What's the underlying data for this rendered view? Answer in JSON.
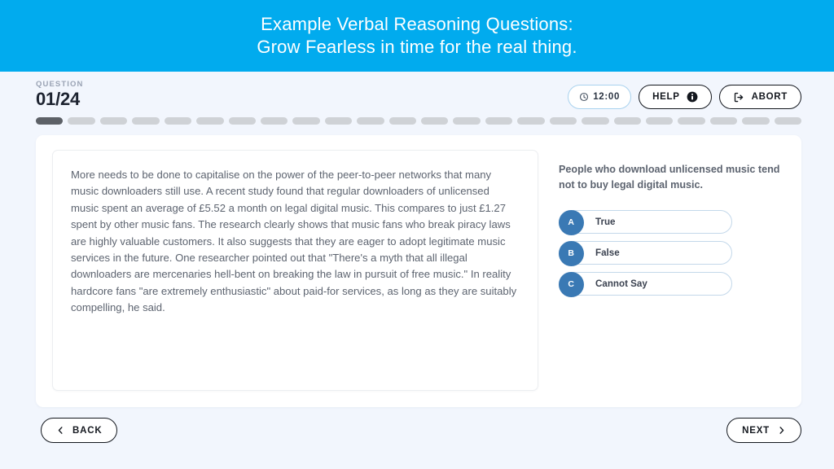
{
  "banner": {
    "line1": "Example Verbal Reasoning Questions:",
    "line2": "Grow Fearless in time for the real thing.",
    "background_color": "#01ABEE"
  },
  "header": {
    "question_label": "QUESTION",
    "question_counter": "01/24",
    "timer": {
      "value": "12:00",
      "icon": "clock-icon",
      "border_color": "#a9d2ee"
    },
    "help_button": {
      "label": "HELP",
      "icon": "info-icon"
    },
    "abort_button": {
      "label": "ABORT",
      "icon": "exit-icon"
    }
  },
  "progress": {
    "total": 24,
    "current": 1,
    "active_color": "#5d6167",
    "inactive_color": "#cfd2d6"
  },
  "passage": {
    "text": "More needs to be done to capitalise on the power of the peer-to-peer networks that many music downloaders still use. A recent study found that regular downloaders of unlicensed music spent an average of £5.52 a month on legal digital music. This compares to just £1.27 spent by other music fans. The research clearly shows that music fans who break piracy laws are highly valuable customers. It also suggests that they are eager to adopt legitimate music services in the future. One researcher pointed out that \"There's a myth that all illegal downloaders are mercenaries hell-bent on breaking the law in pursuit of free music.\" In reality hardcore fans \"are extremely enthusiastic\" about paid-for services, as long as they are suitably compelling, he said."
  },
  "question": {
    "statement": "People who download unlicensed music tend not to buy legal digital music.",
    "options": [
      {
        "key": "A",
        "label": "True"
      },
      {
        "key": "B",
        "label": "False"
      },
      {
        "key": "C",
        "label": "Cannot Say"
      }
    ],
    "badge_color": "#3a79b4",
    "option_border_color": "#c3d8ea"
  },
  "footer": {
    "back_label": "BACK",
    "back_icon": "chevron-left-icon",
    "next_label": "NEXT",
    "next_icon": "chevron-right-icon"
  }
}
